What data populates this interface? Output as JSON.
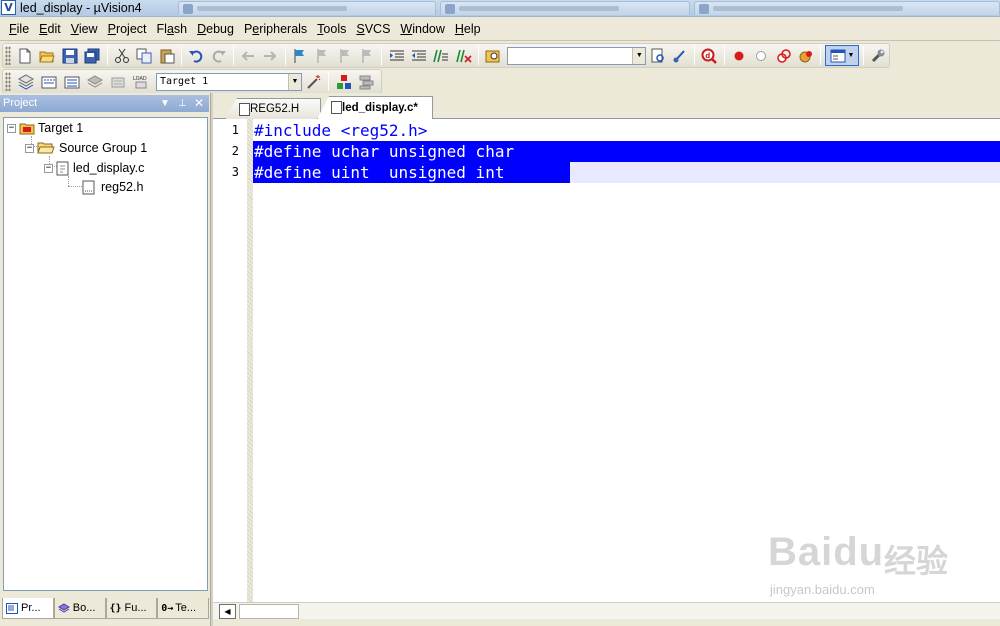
{
  "window": {
    "title": "led_display  - µVision4",
    "app_icon_glyph": "V"
  },
  "menubar": {
    "items": [
      {
        "pre": "",
        "ul": "F",
        "post": "ile"
      },
      {
        "pre": "",
        "ul": "E",
        "post": "dit"
      },
      {
        "pre": "",
        "ul": "V",
        "post": "iew"
      },
      {
        "pre": "",
        "ul": "P",
        "post": "roject"
      },
      {
        "pre": "Fl",
        "ul": "a",
        "post": "sh"
      },
      {
        "pre": "",
        "ul": "D",
        "post": "ebug"
      },
      {
        "pre": "P",
        "ul": "e",
        "post": "ripherals"
      },
      {
        "pre": "",
        "ul": "T",
        "post": "ools"
      },
      {
        "pre": "",
        "ul": "S",
        "post": "VCS"
      },
      {
        "pre": "",
        "ul": "W",
        "post": "indow"
      },
      {
        "pre": "",
        "ul": "H",
        "post": "elp"
      }
    ]
  },
  "toolbar": {
    "find_combo_value": "",
    "target_combo_value": "Target 1",
    "load_label": "LOAD"
  },
  "project_panel": {
    "title": "Project",
    "tree": {
      "target": "Target 1",
      "group": "Source Group 1",
      "file": "led_display.c",
      "include": "reg52.h"
    },
    "tabs": [
      {
        "label": "Pr..."
      },
      {
        "label": "Bo..."
      },
      {
        "label": "Fu..."
      },
      {
        "label": "Te..."
      }
    ],
    "tab_glyphs": [
      "{}",
      "0→"
    ]
  },
  "editor": {
    "tabs": [
      {
        "label": "REG52.H",
        "active": false
      },
      {
        "label": "led_display.c*",
        "active": true
      }
    ],
    "lines": [
      {
        "number": "1",
        "text": "#include <reg52.h>",
        "selected": false
      },
      {
        "number": "2",
        "text": "#define uchar unsigned char",
        "selected": true
      },
      {
        "number": "3",
        "text": "#define uint  unsigned int",
        "selected": true
      }
    ]
  },
  "watermark": {
    "text": "Baidu",
    "cn": "经验",
    "url": "jingyan.baidu.com"
  },
  "colors": {
    "selection": "#0000ff",
    "keyword": "#0000ff",
    "panel_header": "#8ea9d2",
    "chrome": "#ece9d8"
  }
}
